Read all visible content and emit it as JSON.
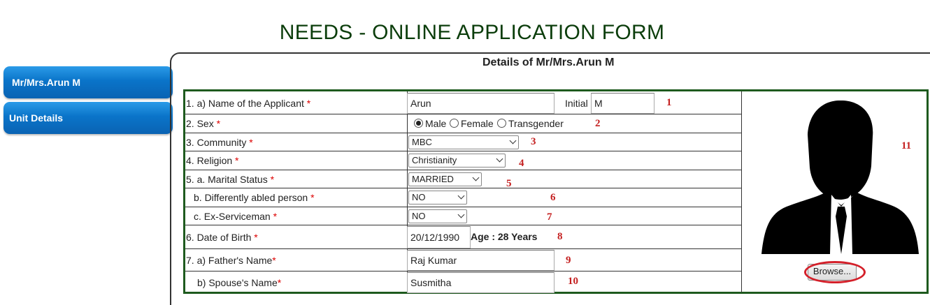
{
  "page": {
    "title": "NEEDS - ONLINE APPLICATION FORM"
  },
  "sidebar": {
    "tabs": [
      {
        "label": "Mr/Mrs.Arun M"
      },
      {
        "label": "Unit Details"
      }
    ]
  },
  "panel": {
    "title": "Details of Mr/Mrs.Arun M"
  },
  "form": {
    "required_mark": "*",
    "name": {
      "label": "1. a) Name of the Applicant",
      "value": "Arun",
      "initial_label": "Initial",
      "initial_value": "M",
      "marker": "1"
    },
    "sex": {
      "label": "2. Sex",
      "options": [
        "Male",
        "Female",
        "Transgender"
      ],
      "selected": "Male",
      "marker": "2"
    },
    "community": {
      "label": "3. Community",
      "value": "MBC",
      "marker": "3"
    },
    "religion": {
      "label": "4. Religion",
      "value": "Christianity",
      "marker": "4"
    },
    "marital": {
      "label": "5. a. Marital Status",
      "value": "MARRIED",
      "marker": "5"
    },
    "disabled": {
      "label": "b. Differently abled person",
      "value": "NO",
      "marker": "6"
    },
    "exservice": {
      "label": "c. Ex-Serviceman",
      "value": "NO",
      "marker": "7"
    },
    "dob": {
      "label": "6. Date of Birth",
      "value": "20/12/1990",
      "age_text": "Age : 28 Years",
      "marker": "8"
    },
    "father": {
      "label": "7. a) Father's Name",
      "value": "Raj Kumar",
      "marker": "9"
    },
    "spouse": {
      "label": "b) Spouse's Name",
      "value": "Susmitha",
      "marker": "10"
    }
  },
  "photo": {
    "marker": "11",
    "browse_label": "Browse..."
  },
  "colors": {
    "title": "#0b3d0b",
    "tab": "#0a74c9",
    "border": "#1e5a1e",
    "marker": "#c42020",
    "highlight": "#d4202a"
  }
}
